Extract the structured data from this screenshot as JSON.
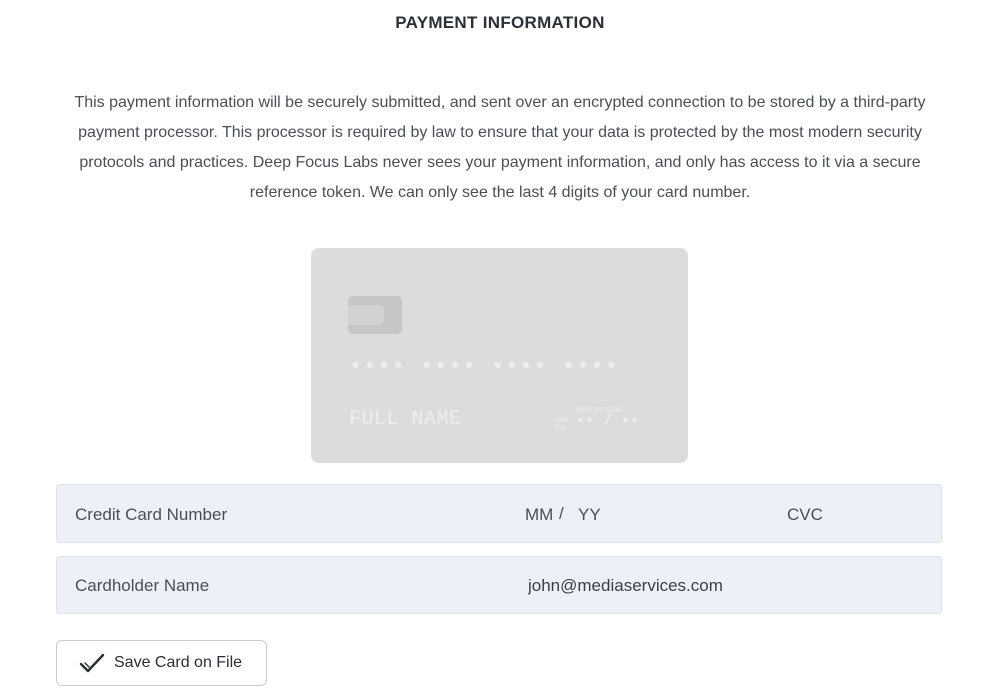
{
  "header": {
    "title": "PAYMENT INFORMATION"
  },
  "description": "This payment information will be securely submitted, and sent over an encrypted connection to be stored by a third-party payment processor. This processor is required by law to ensure that your data is protected by the most modern security protocols and practices. Deep Focus Labs never sees your payment information, and only has access to it via a secure reference token. We can only see the last 4 digits of your card number.",
  "card_preview": {
    "number": "•••• •••• •••• ••••",
    "name": "FULL NAME",
    "valid_label": "valid thru",
    "expiry_label": "MONTH/YEAR",
    "expiry": "•• / ••",
    "chip_icon": "card-chip-icon"
  },
  "form": {
    "card_number_placeholder": "Credit Card Number",
    "month_placeholder": "MM",
    "slash": "/",
    "year_placeholder": "YY",
    "cvc_placeholder": "CVC",
    "cardholder_placeholder": "Cardholder Name",
    "email_value": "john@mediaservices.com"
  },
  "save_button": {
    "label": "Save Card on File",
    "icon": "checkmark-icon"
  }
}
